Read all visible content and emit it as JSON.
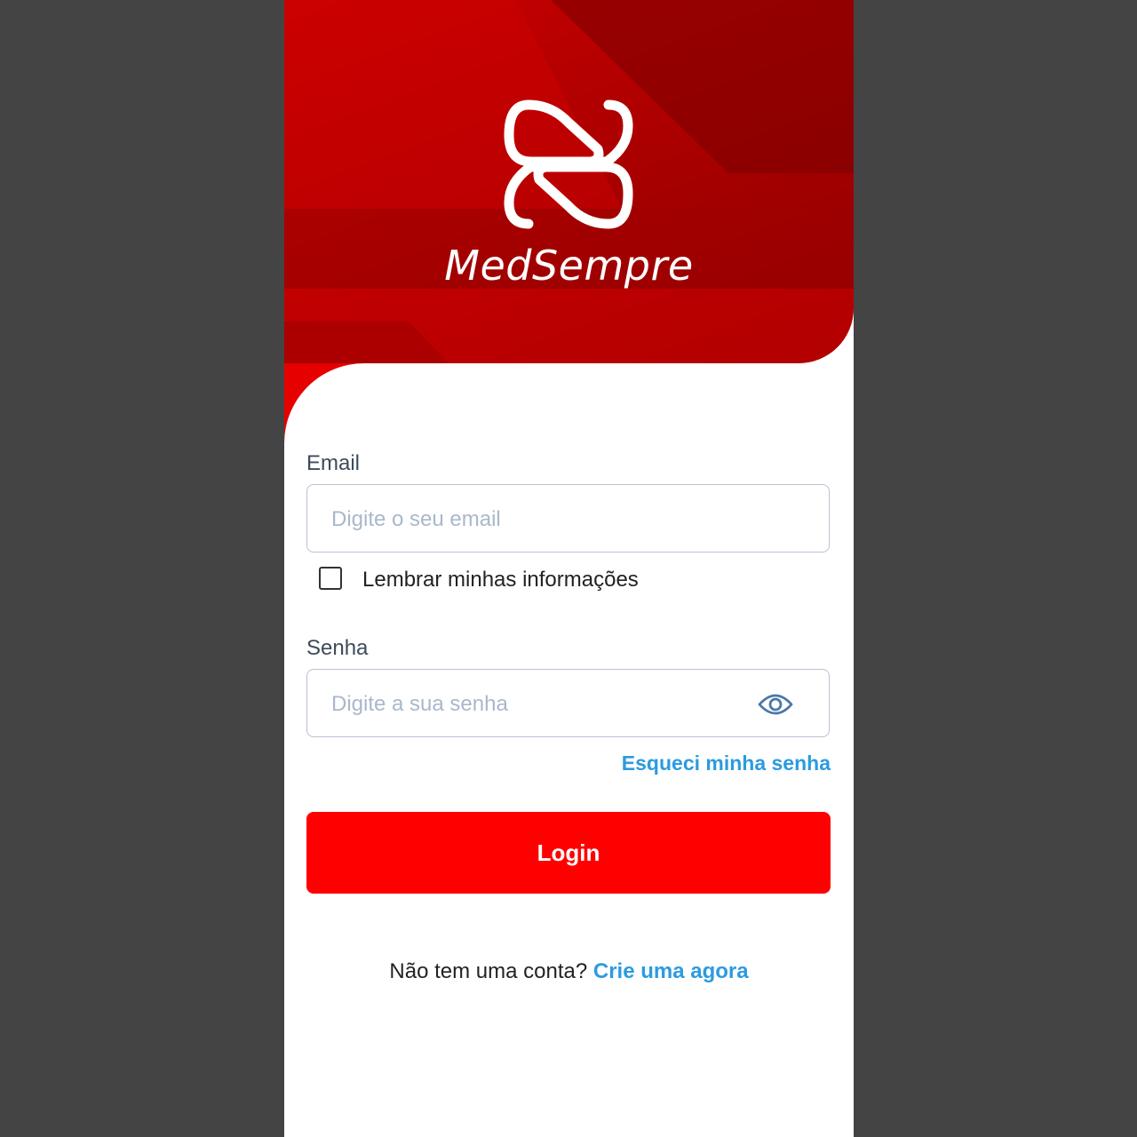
{
  "brand": {
    "name": "MedSempre",
    "logo_icon": "medsempre-logo-icon",
    "primary_color": "#ff0000",
    "header_color": "#b00000",
    "link_color": "#2c9be0"
  },
  "email": {
    "label": "Email",
    "placeholder": "Digite o seu email",
    "value": ""
  },
  "remember": {
    "label": "Lembrar minhas informações",
    "checked": false
  },
  "password": {
    "label": "Senha",
    "placeholder": "Digite a sua senha",
    "value": "",
    "toggle_icon": "eye-icon"
  },
  "forgot_password": "Esqueci minha senha",
  "login_button": "Login",
  "signup": {
    "prompt": "Não tem uma conta?",
    "link": "Crie uma agora"
  }
}
